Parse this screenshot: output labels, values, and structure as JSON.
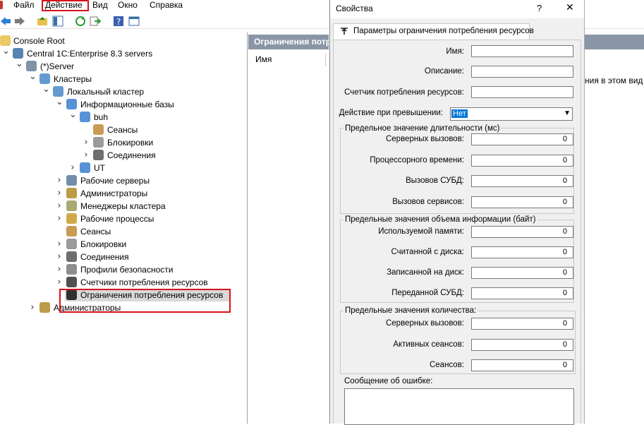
{
  "menubar": {
    "items": [
      "Файл",
      "Действие",
      "Вид",
      "Окно",
      "Справка"
    ]
  },
  "tree": {
    "nodes": [
      "Console Root",
      "Central 1C:Enterprise 8.3 servers",
      "(*)Server",
      "Кластеры",
      "Локальный кластер",
      "Информационные базы",
      "buh",
      "Сеансы",
      "Блокировки",
      "Соединения",
      "UT",
      "Рабочие серверы",
      "Администраторы",
      "Менеджеры кластера",
      "Рабочие процессы",
      "Сеансы",
      "Блокировки",
      "Соединения",
      "Профили безопасности",
      "Счетчики потребления ресурсов",
      "Ограничения потребления ресурсов",
      "Администраторы"
    ]
  },
  "right_panel": {
    "header": "Ограничения потр",
    "column_name": "Имя",
    "right_text": "ния в этом вид"
  },
  "dialog": {
    "title": "Свойства",
    "help": "?",
    "close": "✕",
    "tab": "Параметры ограничения потребления ресурсов",
    "name_label": "Имя:",
    "desc_label": "Описание:",
    "counter_label": "Счетчик потребления ресурсов:",
    "action_label": "Действие при превышении:",
    "action_value": "Нет",
    "group1": {
      "title": "Предельное значение длительности (мс)",
      "rows": [
        {
          "label": "Серверных вызовов:",
          "value": "0"
        },
        {
          "label": "Процессорного времени:",
          "value": "0"
        },
        {
          "label": "Вызовов СУБД:",
          "value": "0"
        },
        {
          "label": "Вызовов сервисов:",
          "value": "0"
        }
      ]
    },
    "group2": {
      "title": "Предельные значения объема информации (байт)",
      "rows": [
        {
          "label": "Используемой памяти:",
          "value": "0"
        },
        {
          "label": "Считанной с диска:",
          "value": "0"
        },
        {
          "label": "Записанной на диск:",
          "value": "0"
        },
        {
          "label": "Переданной СУБД:",
          "value": "0"
        }
      ]
    },
    "group3": {
      "title": "Предельные значения количества:",
      "rows": [
        {
          "label": "Серверных вызовов:",
          "value": "0"
        },
        {
          "label": "Активных сеансов:",
          "value": "0"
        },
        {
          "label": "Сеансов:",
          "value": "0"
        }
      ]
    },
    "error_label": "Сообщение об ошибке:"
  },
  "colors": {
    "highlight": "#d8121a",
    "header": "#8a96a6",
    "dialog_bg": "#f0f0f0"
  }
}
